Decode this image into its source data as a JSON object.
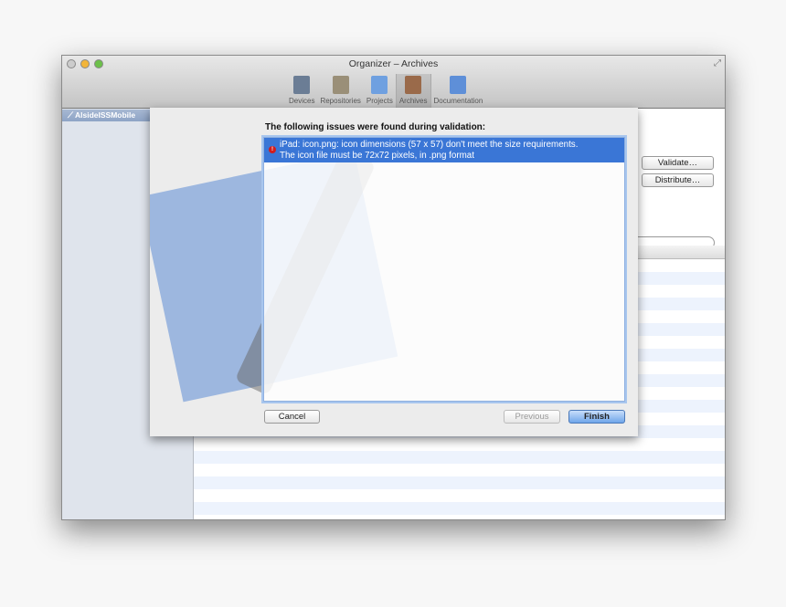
{
  "window": {
    "title": "Organizer – Archives"
  },
  "toolbar": {
    "items": [
      {
        "label": "Devices",
        "color": "#6b7d95"
      },
      {
        "label": "Repositories",
        "color": "#9a8f78"
      },
      {
        "label": "Projects",
        "color": "#6fa0e0"
      },
      {
        "label": "Archives",
        "color": "#9a6a4a",
        "active": true
      },
      {
        "label": "Documentation",
        "color": "#5e8fd8"
      }
    ]
  },
  "sidebar": {
    "items": [
      {
        "label": "AlsideISSMobile",
        "icon": "app-icon",
        "selected": true
      }
    ]
  },
  "actions": {
    "validate": "Validate…",
    "distribute": "Distribute…"
  },
  "sheet": {
    "heading": "The following issues were found during validation:",
    "issues": [
      {
        "icon": "error-icon",
        "line1": "iPad: icon.png: icon dimensions (57 x 57) don't meet the size requirements.",
        "line2": "The icon file must be 72x72 pixels, in .png format"
      }
    ],
    "cancel": "Cancel",
    "previous": "Previous",
    "finish": "Finish"
  },
  "colors": {
    "selection": "#3a76d6",
    "error": "#d21c1c"
  }
}
